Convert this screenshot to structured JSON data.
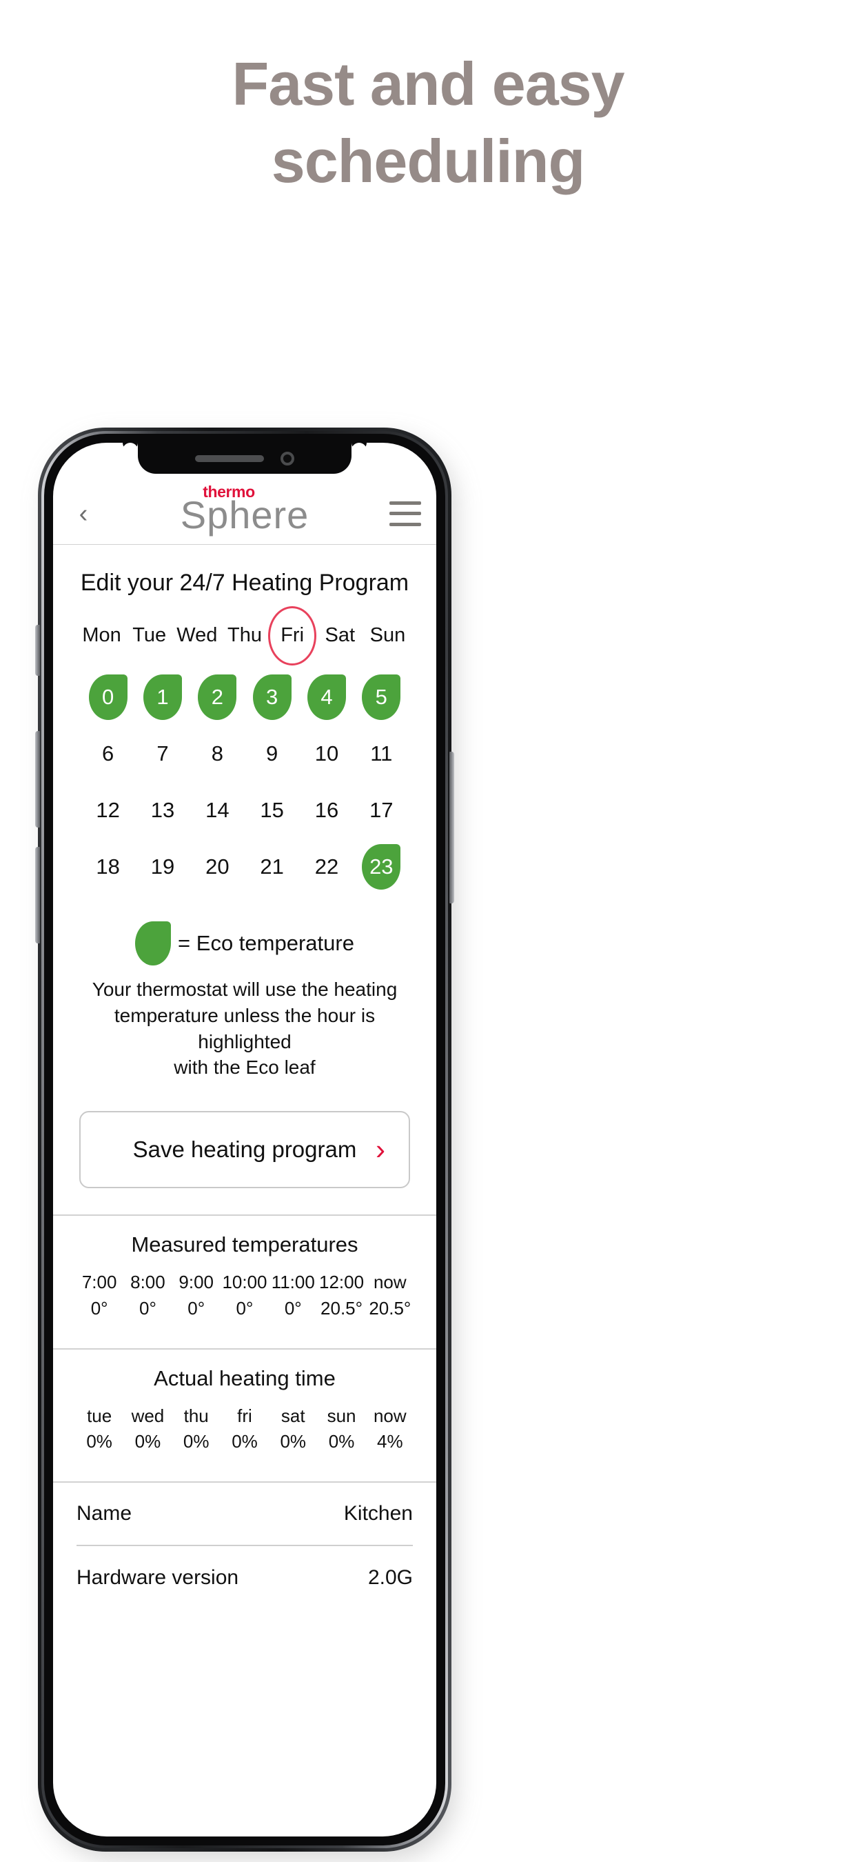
{
  "marketing": {
    "headline_line1": "Fast and easy",
    "headline_line2": "scheduling",
    "headline_color": "#968b88"
  },
  "appbar": {
    "back_label": "‹",
    "logo_top": "thermo",
    "logo_bottom": "Sphere",
    "logo_top_color": "#e0113a",
    "logo_bottom_color": "#8c8c8c",
    "menu_label": "menu"
  },
  "page": {
    "title": "Edit your 24/7 Heating Program"
  },
  "days": [
    {
      "label": "Mon",
      "selected": false
    },
    {
      "label": "Tue",
      "selected": false
    },
    {
      "label": "Wed",
      "selected": false
    },
    {
      "label": "Thu",
      "selected": false
    },
    {
      "label": "Fri",
      "selected": true
    },
    {
      "label": "Sat",
      "selected": false
    },
    {
      "label": "Sun",
      "selected": false
    }
  ],
  "selection_color": "#e8415c",
  "eco_color": "#4ca33c",
  "hours": {
    "rows": [
      [
        {
          "label": "0",
          "eco": true
        },
        {
          "label": "1",
          "eco": true
        },
        {
          "label": "2",
          "eco": true
        },
        {
          "label": "3",
          "eco": true
        },
        {
          "label": "4",
          "eco": true
        },
        {
          "label": "5",
          "eco": true
        }
      ],
      [
        {
          "label": "6",
          "eco": false
        },
        {
          "label": "7",
          "eco": false
        },
        {
          "label": "8",
          "eco": false
        },
        {
          "label": "9",
          "eco": false
        },
        {
          "label": "10",
          "eco": false
        },
        {
          "label": "11",
          "eco": false
        }
      ],
      [
        {
          "label": "12",
          "eco": false
        },
        {
          "label": "13",
          "eco": false
        },
        {
          "label": "14",
          "eco": false
        },
        {
          "label": "15",
          "eco": false
        },
        {
          "label": "16",
          "eco": false
        },
        {
          "label": "17",
          "eco": false
        }
      ],
      [
        {
          "label": "18",
          "eco": false
        },
        {
          "label": "19",
          "eco": false
        },
        {
          "label": "20",
          "eco": false
        },
        {
          "label": "21",
          "eco": false
        },
        {
          "label": "22",
          "eco": false
        },
        {
          "label": "23",
          "eco": true
        }
      ]
    ]
  },
  "legend": {
    "text": "= Eco temperature",
    "note_line1": "Your thermostat will use the heating",
    "note_line2": "temperature unless the hour is highlighted",
    "note_line3": "with the Eco leaf"
  },
  "save_button": {
    "label": "Save heating program",
    "arrow": "›",
    "arrow_color": "#e0113a"
  },
  "measured": {
    "title": "Measured temperatures",
    "columns": [
      {
        "time": "7:00",
        "value": "0°"
      },
      {
        "time": "8:00",
        "value": "0°"
      },
      {
        "time": "9:00",
        "value": "0°"
      },
      {
        "time": "10:00",
        "value": "0°"
      },
      {
        "time": "11:00",
        "value": "0°"
      },
      {
        "time": "12:00",
        "value": "20.5°"
      },
      {
        "time": "now",
        "value": "20.5°"
      }
    ]
  },
  "heating_time": {
    "title": "Actual heating time",
    "columns": [
      {
        "day": "tue",
        "value": "0%"
      },
      {
        "day": "wed",
        "value": "0%"
      },
      {
        "day": "thu",
        "value": "0%"
      },
      {
        "day": "fri",
        "value": "0%"
      },
      {
        "day": "sat",
        "value": "0%"
      },
      {
        "day": "sun",
        "value": "0%"
      },
      {
        "day": "now",
        "value": "4%"
      }
    ]
  },
  "device_info": [
    {
      "key": "Name",
      "value": "Kitchen"
    },
    {
      "key": "Hardware version",
      "value": "2.0G"
    }
  ]
}
